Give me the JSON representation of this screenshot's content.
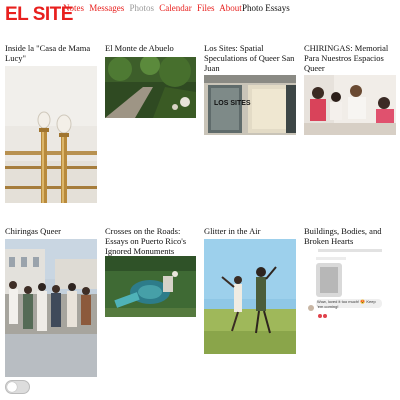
{
  "brand": {
    "logo": "EL SITE"
  },
  "nav": {
    "items": [
      "Notes",
      "Messages",
      "Photos",
      "Calendar",
      "Files",
      "About"
    ],
    "extra": "Photo Essays"
  },
  "cards": [
    {
      "title": "Inside la \"Casa de Mama Lucy\""
    },
    {
      "title": "El Monte de Abuelo"
    },
    {
      "title": "Los Sites: Spatial Speculations of Queer San Juan"
    },
    {
      "title": "CHIRINGAS: Memorial Para Nuestros Espacios Queer"
    },
    {
      "title": "Chiringas Queer"
    },
    {
      "title": "Crosses on the Roads: Essays on Puerto Rico's Ignored Monuments"
    },
    {
      "title": "Glitter in the Air"
    },
    {
      "title": "Buildings, Bodies, and Broken Hearts"
    }
  ],
  "thumbs": {
    "los_sites_sign": "LOS SITES",
    "chat_message": "Wow, loved it too much! 😍 Keep 'em coming!"
  },
  "colors": {
    "accent": "#e8201e"
  }
}
